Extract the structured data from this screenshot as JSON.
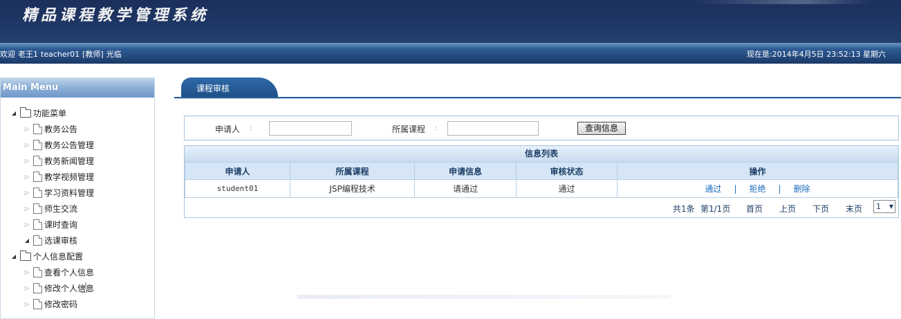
{
  "header": {
    "title": "精品课程教学管理系统"
  },
  "status_bar": {
    "welcome_prefix": "欢迎",
    "user_name": "老王1",
    "account": "teacher01",
    "role": "[教师]",
    "greeting": "光临",
    "datetime": "现在是:2014年4月5日 23:52:13 星期六"
  },
  "sidebar": {
    "title": "Main Menu",
    "items": [
      {
        "label": "功能菜单",
        "level": 0,
        "type": "folder",
        "expanded": true
      },
      {
        "label": "教务公告",
        "level": 1,
        "type": "file"
      },
      {
        "label": "教务公告管理",
        "level": 1,
        "type": "file"
      },
      {
        "label": "教务新闻管理",
        "level": 1,
        "type": "file"
      },
      {
        "label": "教学视频管理",
        "level": 1,
        "type": "file"
      },
      {
        "label": "学习资料管理",
        "level": 1,
        "type": "file"
      },
      {
        "label": "师生交流",
        "level": 1,
        "type": "file"
      },
      {
        "label": "课时查询",
        "level": 1,
        "type": "file"
      },
      {
        "label": "选课审核",
        "level": 1,
        "type": "file",
        "selected": true
      },
      {
        "label": "个人信息配置",
        "level": 0,
        "type": "folder",
        "expanded": true
      },
      {
        "label": "查看个人信息",
        "level": 1,
        "type": "file"
      },
      {
        "label": "修改个人信息",
        "level": 1,
        "type": "file"
      },
      {
        "label": "修改密码",
        "level": 1,
        "type": "file"
      }
    ]
  },
  "tab": {
    "label": "课程审核"
  },
  "search": {
    "applicant_label": "申请人",
    "applicant_value": "",
    "course_label": "所属课程",
    "course_value": "",
    "button": "查询信息"
  },
  "list": {
    "title": "信息列表",
    "columns": [
      "申请人",
      "所属课程",
      "申请信息",
      "审核状态",
      "操作"
    ],
    "rows": [
      {
        "applicant": "student01",
        "course": "JSP编程技术",
        "info": "请通过",
        "status": "通过",
        "actions": [
          "通过",
          "拒绝",
          "删除"
        ]
      }
    ],
    "pager": {
      "total": "共1条",
      "page": "第1/1页",
      "first": "首页",
      "prev": "上页",
      "next": "下页",
      "last": "末页",
      "select_value": "1"
    }
  },
  "colors": {
    "header_bg": "#1e3766",
    "accent": "#2a5f98",
    "link": "#1a6dc0"
  }
}
